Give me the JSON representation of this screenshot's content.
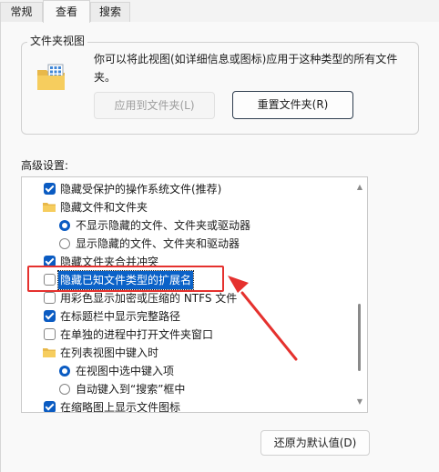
{
  "tabs": [
    {
      "label": "常规"
    },
    {
      "label": "查看"
    },
    {
      "label": "搜索"
    }
  ],
  "folder_views": {
    "title": "文件夹视图",
    "description": "你可以将此视图(如详细信息或图标)应用于这种类型的所有文件夹。",
    "apply_button": "应用到文件夹(L)",
    "reset_button": "重置文件夹(R)"
  },
  "advanced": {
    "label": "高级设置:",
    "items": [
      {
        "type": "checkbox",
        "checked": true,
        "label": "隐藏受保护的操作系统文件(推荐)"
      },
      {
        "type": "folder",
        "label": "隐藏文件和文件夹"
      },
      {
        "type": "radio",
        "checked": true,
        "label": "不显示隐藏的文件、文件夹或驱动器"
      },
      {
        "type": "radio",
        "checked": false,
        "label": "显示隐藏的文件、文件夹和驱动器"
      },
      {
        "type": "checkbox",
        "checked": true,
        "label": "隐藏文件夹合并冲突"
      },
      {
        "type": "checkbox",
        "checked": false,
        "label": "隐藏已知文件类型的扩展名",
        "selected": true
      },
      {
        "type": "checkbox",
        "checked": false,
        "label": "用彩色显示加密或压缩的 NTFS 文件"
      },
      {
        "type": "checkbox",
        "checked": true,
        "label": "在标题栏中显示完整路径"
      },
      {
        "type": "checkbox",
        "checked": false,
        "label": "在单独的进程中打开文件夹窗口"
      },
      {
        "type": "folder",
        "label": "在列表视图中键入时"
      },
      {
        "type": "radio",
        "checked": true,
        "label": "在视图中选中键入项"
      },
      {
        "type": "radio",
        "checked": false,
        "label": "自动键入到“搜索”框中"
      },
      {
        "type": "checkbox",
        "checked": true,
        "label": "在缩略图上显示文件图标"
      }
    ]
  },
  "restore_button": "还原为默认值(D)",
  "colors": {
    "accent": "#0a5bc2",
    "selection": "#0b62c8",
    "annotation": "#e5312e"
  }
}
